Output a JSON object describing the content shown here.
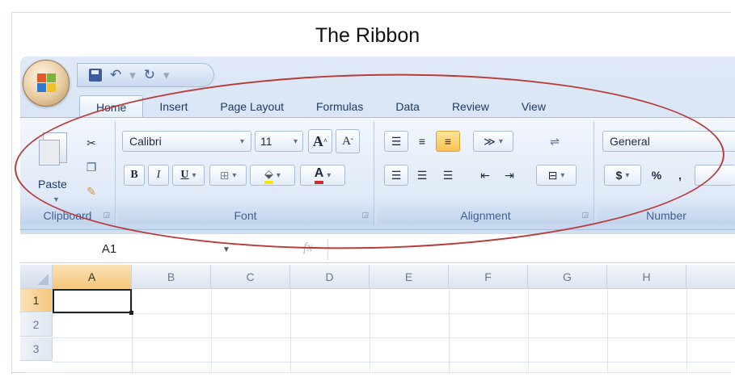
{
  "figure_title": "The Ribbon",
  "tabs": [
    "Home",
    "Insert",
    "Page Layout",
    "Formulas",
    "Data",
    "Review",
    "View"
  ],
  "groups": {
    "clipboard": {
      "label": "Clipboard",
      "paste": "Paste"
    },
    "font": {
      "label": "Font",
      "font_name": "Calibri",
      "font_size": "11",
      "bold": "B",
      "italic": "I",
      "underline": "U",
      "grow": "A",
      "shrink": "A",
      "font_color": "A"
    },
    "alignment": {
      "label": "Alignment"
    },
    "number": {
      "label": "Number",
      "format": "General",
      "currency": "$",
      "percent": "%",
      "comma": ","
    }
  },
  "formula_bar": {
    "name_box": "A1",
    "fx": "fx"
  },
  "columns": [
    "A",
    "B",
    "C",
    "D",
    "E",
    "F",
    "G",
    "H"
  ],
  "rows": [
    "1",
    "2",
    "3"
  ],
  "colors": {
    "highlight": "#f9c24f",
    "ellipse": "#b83a3a",
    "font_color_bar": "#d22a2a",
    "fill_bar": "#f6e800"
  }
}
